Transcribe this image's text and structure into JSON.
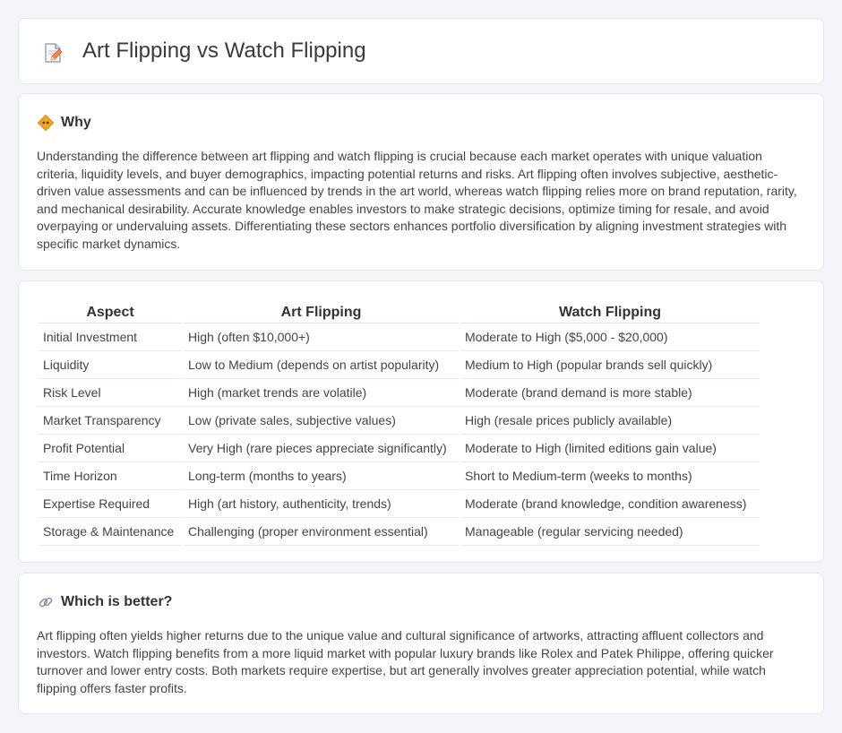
{
  "header": {
    "title": "Art Flipping vs Watch Flipping",
    "icon": "document-pencil-icon"
  },
  "why": {
    "heading": "Why",
    "icon": "diamond-sign-icon",
    "text": "Understanding the difference between art flipping and watch flipping is crucial because each market operates with unique valuation criteria, liquidity levels, and buyer demographics, impacting potential returns and risks. Art flipping often involves subjective, aesthetic-driven value assessments and can be influenced by trends in the art world, whereas watch flipping relies more on brand reputation, rarity, and mechanical desirability. Accurate knowledge enables investors to make strategic decisions, optimize timing for resale, and avoid overpaying or undervaluing assets. Differentiating these sectors enhances portfolio diversification by aligning investment strategies with specific market dynamics."
  },
  "table": {
    "headers": [
      "Aspect",
      "Art Flipping",
      "Watch Flipping"
    ],
    "rows": [
      [
        "Initial Investment",
        "High (often $10,000+)",
        "Moderate to High ($5,000 - $20,000)"
      ],
      [
        "Liquidity",
        "Low to Medium (depends on artist popularity)",
        "Medium to High (popular brands sell quickly)"
      ],
      [
        "Risk Level",
        "High (market trends are volatile)",
        "Moderate (brand demand is more stable)"
      ],
      [
        "Market Transparency",
        "Low (private sales, subjective values)",
        "High (resale prices publicly available)"
      ],
      [
        "Profit Potential",
        "Very High (rare pieces appreciate significantly)",
        "Moderate to High (limited editions gain value)"
      ],
      [
        "Time Horizon",
        "Long-term (months to years)",
        "Short to Medium-term (weeks to months)"
      ],
      [
        "Expertise Required",
        "High (art history, authenticity, trends)",
        "Moderate (brand knowledge, condition awareness)"
      ],
      [
        "Storage & Maintenance",
        "Challenging (proper environment essential)",
        "Manageable (regular servicing needed)"
      ]
    ]
  },
  "better": {
    "heading": "Which is better?",
    "icon": "link-icon",
    "text": "Art flipping often yields higher returns due to the unique value and cultural significance of artworks, attracting affluent collectors and investors. Watch flipping benefits from a more liquid market with popular luxury brands like Rolex and Patek Philippe, offering quicker turnover and lower entry costs. Both markets require expertise, but art generally involves greater appreciation potential, while watch flipping offers faster profits."
  }
}
